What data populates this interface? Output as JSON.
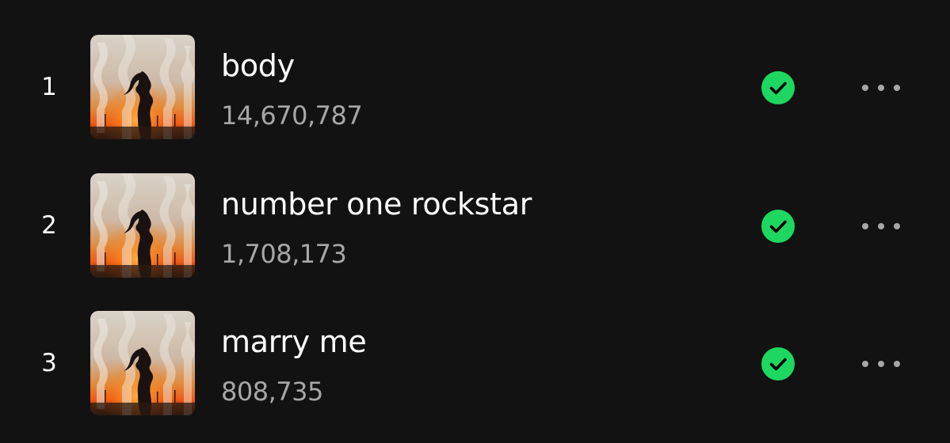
{
  "tracks": [
    {
      "number": "1",
      "title": "body",
      "plays": "14,670,787",
      "saved": true
    },
    {
      "number": "2",
      "title": "number one rockstar",
      "plays": "1,708,173",
      "saved": true
    },
    {
      "number": "3",
      "title": "marry me",
      "plays": "808,735",
      "saved": true
    }
  ],
  "icons": {
    "saved": "check-circle-icon",
    "more": "more-options-icon"
  },
  "colors": {
    "background": "#121212",
    "accent": "#1ed760",
    "title": "#ffffff",
    "secondary": "#a7a7a7"
  }
}
